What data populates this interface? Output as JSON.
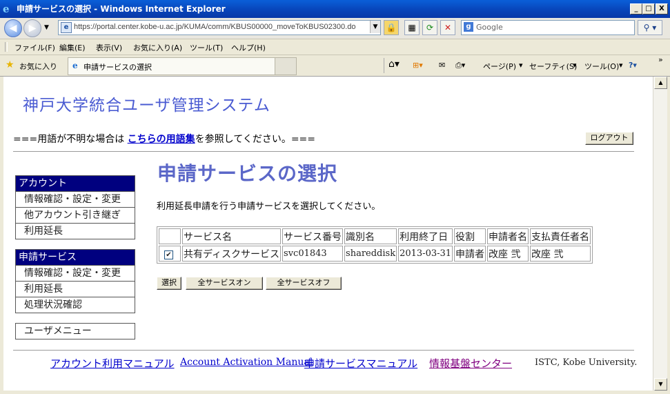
{
  "window": {
    "title": "申請サービスの選択 - Windows Internet Explorer",
    "minimize": "_",
    "maximize": "□",
    "close": "X"
  },
  "address": {
    "url": "https://portal.center.kobe-u.ac.jp/KUMA/comm/KBUS00000_moveToKBUS02300.do",
    "search_placeholder": "Google"
  },
  "menu": [
    "ファイル(F)",
    "編集(E)",
    "表示(V)",
    "お気に入り(A)",
    "ツール(T)",
    "ヘルプ(H)"
  ],
  "favorites_label": "お気に入り",
  "tab_title": "申請サービスの選択",
  "command_bar": {
    "page": "ページ(P)",
    "safety": "セーフティ(S)",
    "tools": "ツール(O)"
  },
  "page": {
    "system_title": "神戸大学統合ユーザ管理システム",
    "notice_prefix": "===用語が不明な場合は ",
    "notice_link": "こちらの用語集",
    "notice_suffix": "を参照してください。===",
    "logout_button": "ログアウト",
    "title": "申請サービスの選択",
    "instruction": "利用延長申請を行う申請サービスを選択してください。"
  },
  "sidebar": {
    "account": {
      "header": "アカウント",
      "items": [
        "情報確認・設定・変更",
        "他アカウント引き継ぎ",
        "利用延長"
      ]
    },
    "service": {
      "header": "申請サービス",
      "items": [
        "情報確認・設定・変更",
        "利用延長",
        "処理状況確認"
      ]
    },
    "user_menu": "ユーザメニュー"
  },
  "table": {
    "headers": [
      "",
      "サービス名",
      "サービス番号",
      "識別名",
      "利用終了日",
      "役割",
      "申請者名",
      "支払責任者名"
    ],
    "rows": [
      {
        "checked": "✔",
        "service_name": "共有ディスクサービス",
        "service_number": "svc01843",
        "identifier": "shareddisk",
        "end_date": "2013-03-31",
        "role": "申請者",
        "applicant": "改座 弐",
        "payer": "改座 弐"
      }
    ]
  },
  "actions": {
    "select": "選択",
    "all_on": "全サービスオン",
    "all_off": "全サービスオフ"
  },
  "footer": {
    "account_manual": "アカウント利用マニュアル",
    "activation_manual": "Account Activation Manual",
    "service_manual": "申請サービスマニュアル",
    "center": "情報基盤センター",
    "copyright": "ISTC, Kobe University."
  }
}
